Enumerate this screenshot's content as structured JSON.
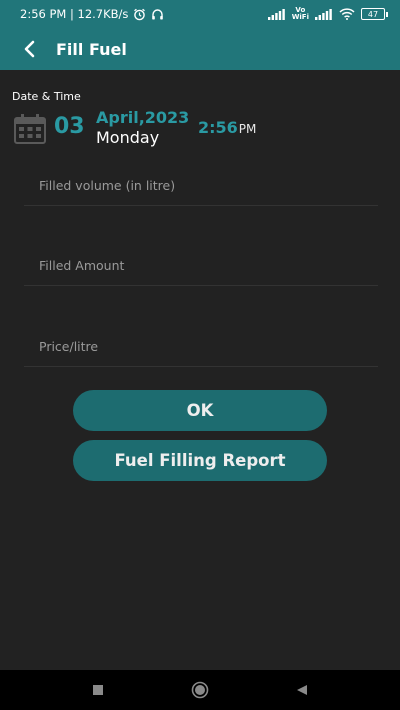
{
  "status_bar": {
    "time_speed": "2:56 PM | 12.7KB/s",
    "volte_label": "Vo",
    "wifi_label": "WiFi",
    "battery": "47"
  },
  "app_bar": {
    "title": "Fill Fuel"
  },
  "datetime": {
    "label": "Date & Time",
    "day": "03",
    "month_year": "April,2023",
    "weekday": "Monday",
    "time": "2:56",
    "ampm": "PM"
  },
  "form": {
    "volume_placeholder": "Filled volume (in litre)",
    "amount_placeholder": "Filled Amount",
    "price_placeholder": "Price/litre"
  },
  "buttons": {
    "ok": "OK",
    "report": "Fuel Filling Report"
  },
  "colors": {
    "primary": "#21767a",
    "accent": "#2a9aa3",
    "background": "#222222",
    "button": "#1d6c70"
  }
}
